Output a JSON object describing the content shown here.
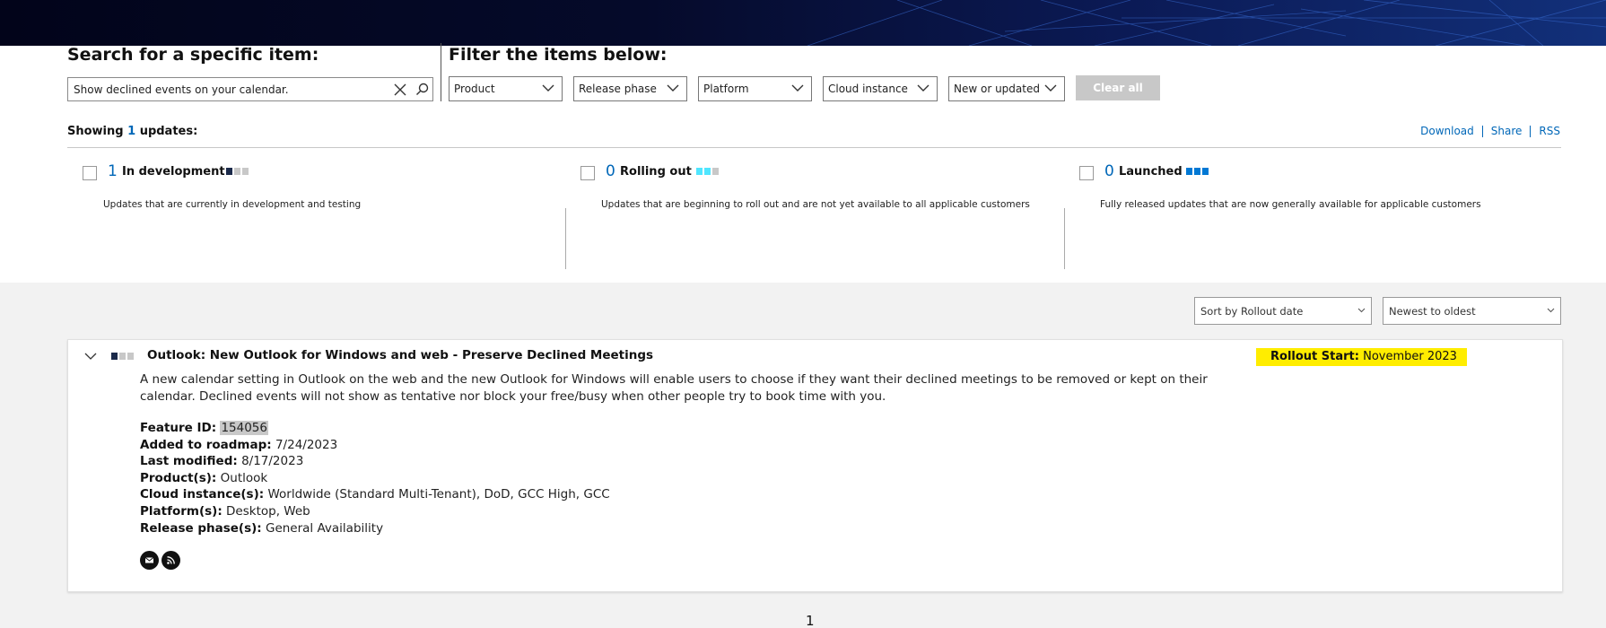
{
  "search": {
    "title": "Search for a specific item:",
    "value": "Show declined events on your calendar."
  },
  "filters": {
    "title": "Filter the items below:",
    "dropdowns": [
      "Product",
      "Release phase",
      "Platform",
      "Cloud instance",
      "New or updated"
    ],
    "clear_all": "Clear all"
  },
  "summary": {
    "showing_prefix": "Showing",
    "count": "1",
    "showing_suffix": "updates",
    "colon": ":",
    "links": [
      "Download",
      "Share",
      "RSS"
    ]
  },
  "statuses": [
    {
      "count": "1",
      "label": "In development",
      "desc": "Updates that are currently in development and testing"
    },
    {
      "count": "0",
      "label": "Rolling out",
      "desc": "Updates that are beginning to roll out and are not yet available to all applicable customers"
    },
    {
      "count": "0",
      "label": "Launched",
      "desc": "Fully released updates that are now generally available for applicable customers"
    }
  ],
  "sort": {
    "by": "Sort by Rollout date",
    "order": "Newest to oldest"
  },
  "item": {
    "title": "Outlook: New Outlook for Windows and web - Preserve Declined Meetings",
    "rollout_label": "Rollout Start:",
    "rollout_value": "November 2023",
    "description": "A new calendar setting in Outlook on the web and the new Outlook for Windows will enable users to choose if they want their declined meetings to be removed or kept on their calendar. Declined events will not show as tentative nor block your free/busy when other people try to book time with you.",
    "details": [
      {
        "key": "Feature ID:",
        "value": "154056"
      },
      {
        "key": "Added to roadmap:",
        "value": "7/24/2023"
      },
      {
        "key": "Last modified:",
        "value": "8/17/2023"
      },
      {
        "key": "Product(s):",
        "value": "Outlook"
      },
      {
        "key": "Cloud instance(s):",
        "value": "Worldwide (Standard Multi-Tenant), DoD, GCC High, GCC"
      },
      {
        "key": "Platform(s):",
        "value": "Desktop, Web"
      },
      {
        "key": "Release phase(s):",
        "value": "General Availability"
      }
    ],
    "icons": [
      "email-icon",
      "rss-icon"
    ]
  },
  "pagination": {
    "current": "1"
  },
  "colors": {
    "accent": "#0067b8",
    "highlight": "#ffed00",
    "status_dark": "#1b2a4a",
    "status_cyan": "#50e6ff",
    "status_blue": "#0078d4",
    "status_empty": "#c8c8c8"
  }
}
